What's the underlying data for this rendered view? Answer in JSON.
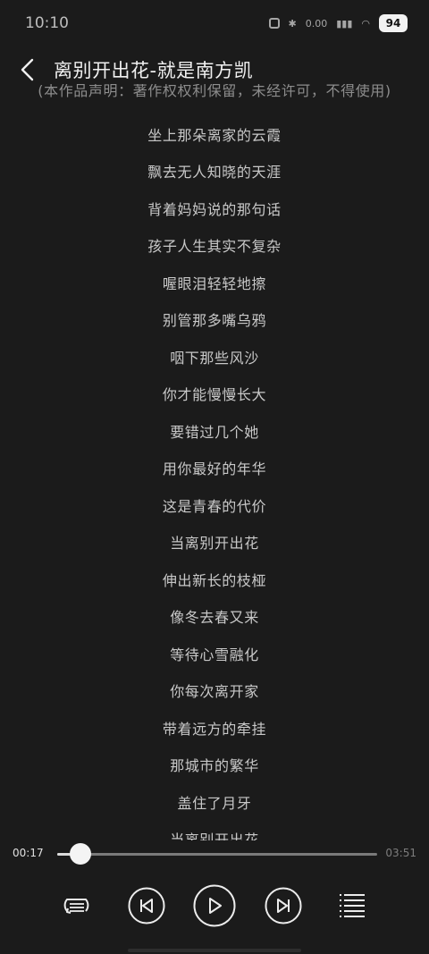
{
  "status_bar": {
    "time": "10:10",
    "net_speed": "0.00",
    "battery": "94"
  },
  "header": {
    "title": "离别开出花-就是南方凯"
  },
  "lyrics": {
    "lines": [
      "(本作品声明：著作权权利保留，未经许可，不得使用)",
      "坐上那朵离家的云霞",
      "飘去无人知晓的天涯",
      "背着妈妈说的那句话",
      "孩子人生其实不复杂",
      "喔眼泪轻轻地擦",
      "别管那多嘴乌鸦",
      "咽下那些风沙",
      "你才能慢慢长大",
      "要错过几个她",
      "用你最好的年华",
      "这是青春的代价",
      "当离别开出花",
      "伸出新长的枝桠",
      "像冬去春又来",
      "等待心雪融化",
      "你每次离开家",
      "带着远方的牵挂",
      "那城市的繁华",
      "盖住了月牙",
      "当离别开出花"
    ]
  },
  "player": {
    "current_time": "00:17",
    "total_time": "03:51",
    "progress": 0.074
  }
}
